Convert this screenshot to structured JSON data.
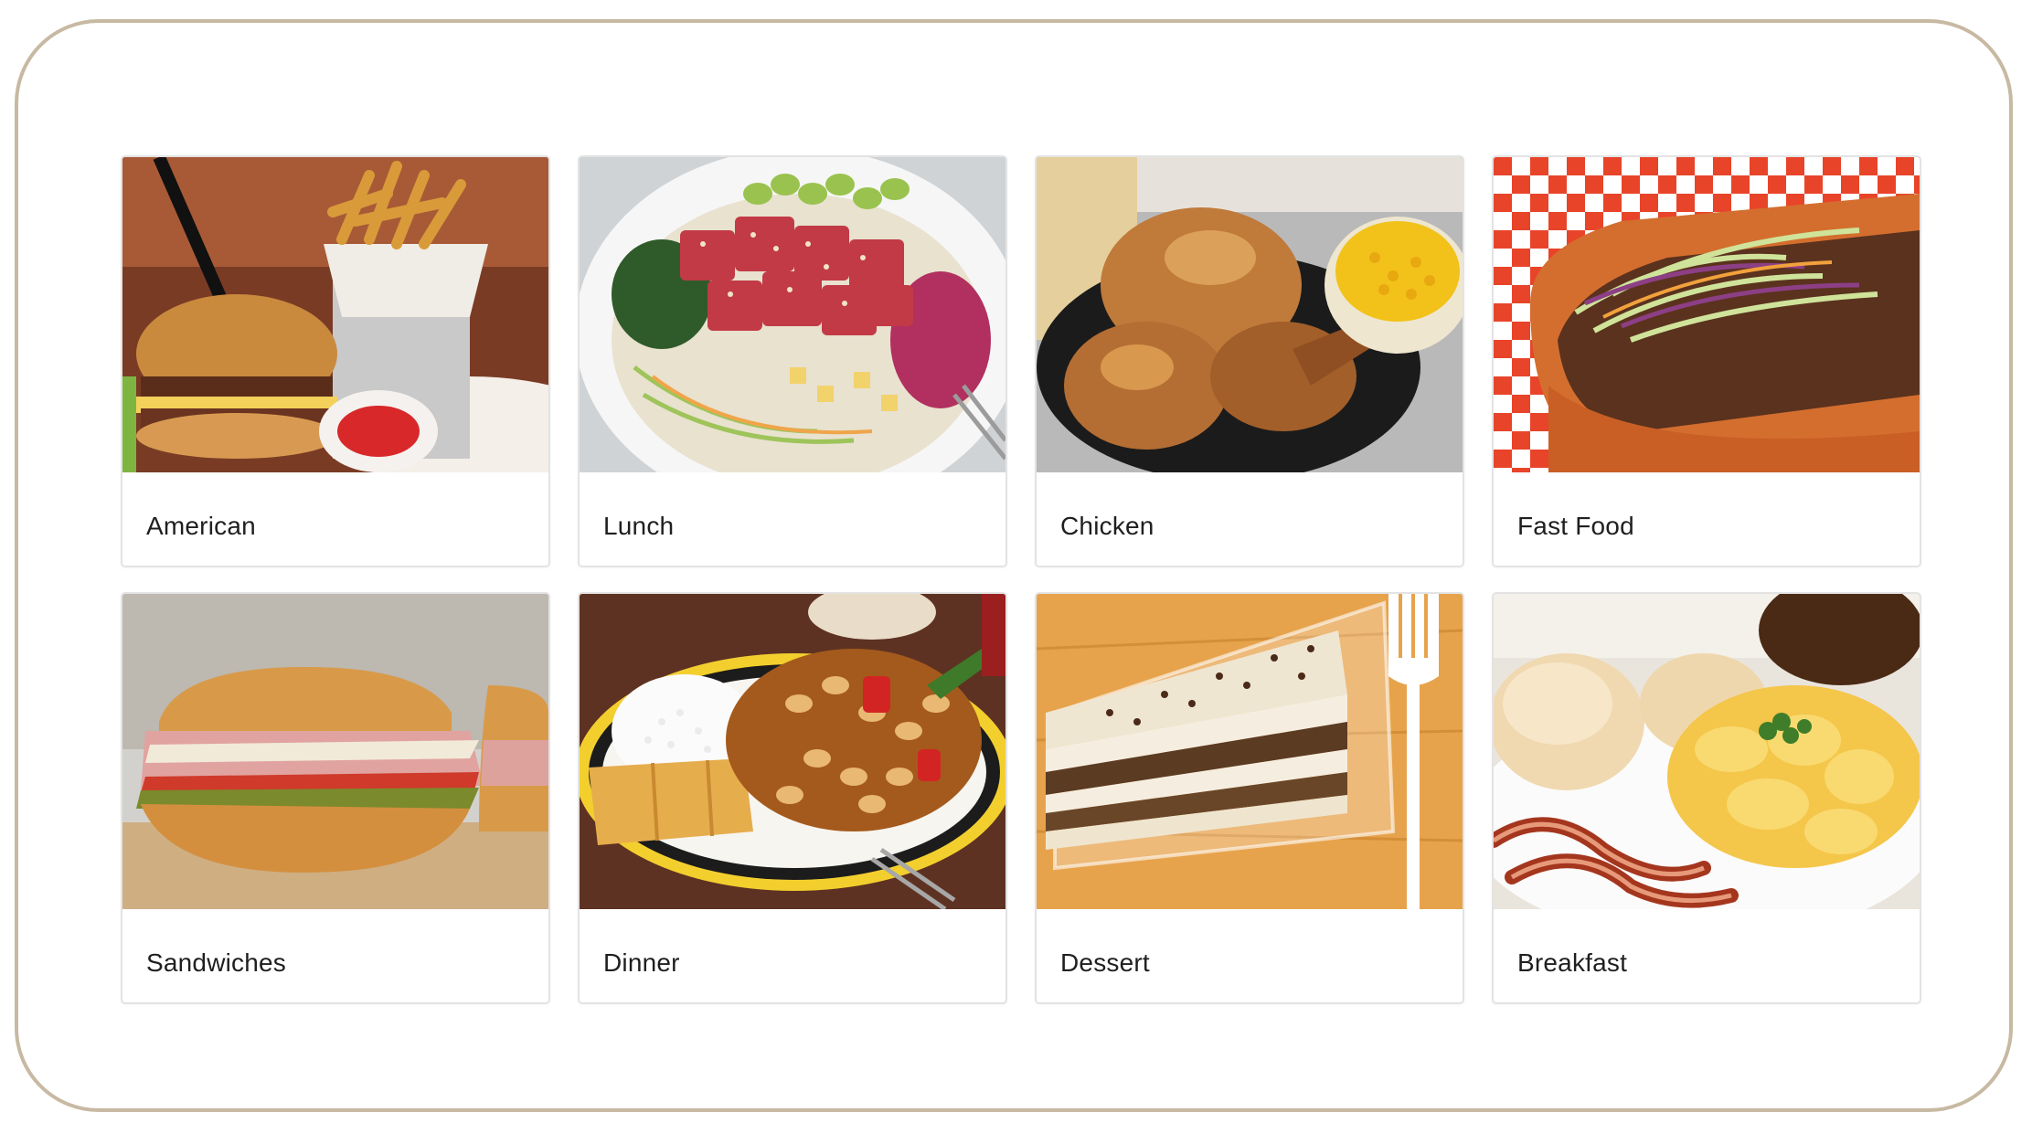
{
  "categories": [
    {
      "label": "American",
      "image": "burger-and-fries-photo"
    },
    {
      "label": "Lunch",
      "image": "poke-bowl-photo"
    },
    {
      "label": "Chicken",
      "image": "roast-chicken-photo"
    },
    {
      "label": "Fast Food",
      "image": "sandwich-with-slaw-photo"
    },
    {
      "label": "Sandwiches",
      "image": "deli-sandwich-photo"
    },
    {
      "label": "Dinner",
      "image": "rice-plate-photo"
    },
    {
      "label": "Dessert",
      "image": "tiramisu-slice-photo"
    },
    {
      "label": "Breakfast",
      "image": "eggs-bacon-biscuit-photo"
    }
  ],
  "colors": {
    "frame_border": "#c7b9a2",
    "card_border": "#e3e3e3",
    "label_text": "#1f1f1f"
  }
}
